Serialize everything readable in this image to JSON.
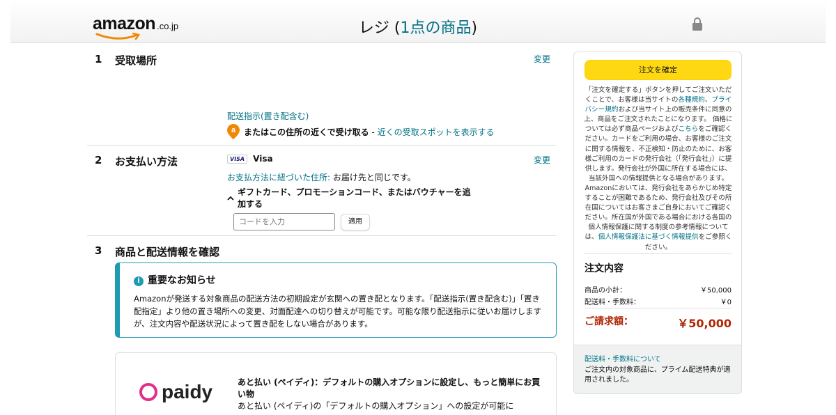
{
  "header": {
    "logo_text": "amazon",
    "logo_domain": ".co.jp",
    "title_prefix": "レジ (",
    "title_count": "1点の商品",
    "title_suffix": ")"
  },
  "sections": {
    "pickup": {
      "number": "1",
      "title": "受取場所",
      "change": "変更",
      "delivery_instructions_link": "配送指示(置き配含む)",
      "pickup_nearby_text": "またはこの住所の近くで受け取る",
      "pickup_separator": " - ",
      "pickup_spots_link": "近くの受取スポットを表示する",
      "pickup_icon_letter": "a"
    },
    "payment": {
      "number": "2",
      "title": "お支払い方法",
      "change": "変更",
      "card_brand_badge": "VISA",
      "card_name": "Visa",
      "billing_label": "お支払方法に紐づいた住所:",
      "billing_value": " お届け先と同じです。",
      "gift_card_toggle": "ギフトカード、プロモーションコード、またはバウチャーを追加する",
      "code_placeholder": "コードを入力",
      "apply_button": "適用"
    },
    "items": {
      "number": "3",
      "title": "商品と配送情報を確認",
      "notice_title": "重要なお知らせ",
      "notice_body": "Amazonが発送する対象商品の配送方法の初期設定が玄関への置き配となります。「配送指示(置き配含む)」「置き配指定」より他の置き場所への変更、対面配達への切り替えが可能です。可能な限り配送指示に従いお届けしますが、注文内容や配送状況によって置き配をしない場合があります。",
      "paidy_logo": "paidy",
      "paidy_title": "あと払い (ペイディ)：デフォルトの購入オプションに設定し、もっと簡単にお買い物",
      "paidy_body": "あと払い (ペイディ)の「デフォルトの購入オプション」への設定が可能に"
    }
  },
  "sidebar": {
    "confirm_button": "注文を確定",
    "legal_1": "「注文を確定する」ボタンを押してご注文いただくことで、お客様は当サイトの",
    "legal_link_1": "各種規約",
    "legal_2": "、",
    "legal_link_2": "プライバシー規約",
    "legal_3": "および当サイト上の販売条件に同意の上、商品をご注文されたことになります。 価格については必ず商品ページおよび",
    "legal_link_3": "こちら",
    "legal_4": "をご確認ください。カードをご利用の場合、お客様のご注文に関する情報を、不正検知・防止のために、お客様ご利用のカードの発行会社（「発行会社」）に提供します。発行会社が外国に所在する場合には、当該外国への情報提供となる場合があります。Amazonにおいては、発行会社をあらかじめ特定することが困難であるため、発行会社及びその所在国についてはお客さまご自身においてご確認ください。所在国が外国である場合における各国の個人情報保護に関する制度の参考情報については、",
    "legal_link_4": "個人情報保護法に基づく情報提供",
    "legal_5": "をご参照ください。",
    "summary_title": "注文内容",
    "subtotal_label": "商品の小計：",
    "subtotal_value": "￥50,000",
    "shipping_label": "配送料・手数料：",
    "shipping_value": "￥0",
    "total_label": "ご請求額：",
    "total_value": "￥50,000",
    "fees_link": "配送料・手数料について",
    "prime_note": "ご注文内の対象商品に、プライム配送特典が適用されました。"
  },
  "colors": {
    "link": "#007185",
    "button_yellow": "#ffd814",
    "total_red": "#b12704",
    "notice_teal": "#1d9bb0",
    "pickup_orange": "#f08804",
    "paidy_pink": "#e0308a"
  },
  "icons": [
    "amazon-smile-icon",
    "lock-icon",
    "pickup-location-icon",
    "visa-card-icon",
    "chevron-up-icon",
    "info-icon",
    "paidy-logo-icon"
  ]
}
